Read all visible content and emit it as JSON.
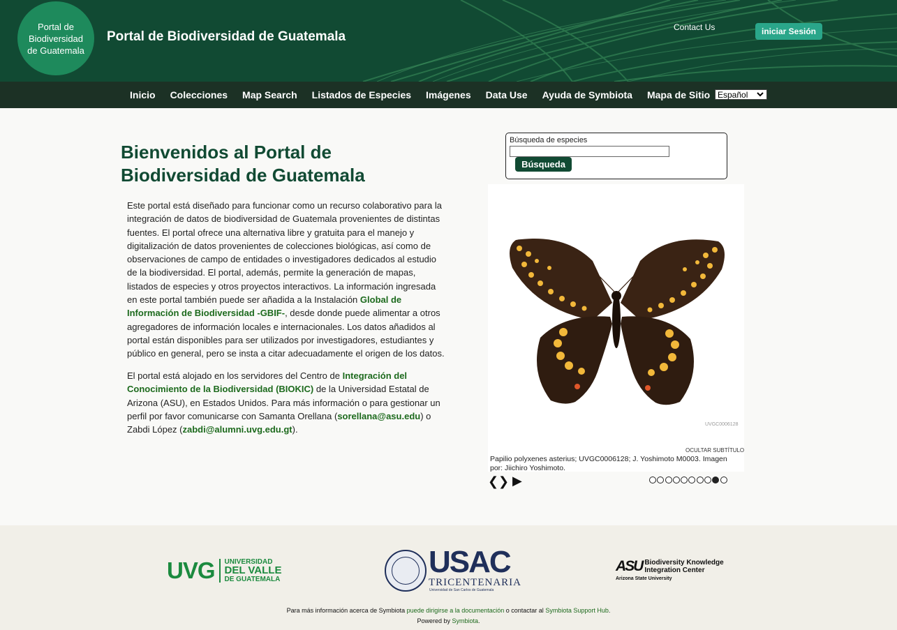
{
  "header": {
    "logo_lines": [
      "Portal de",
      "Biodiversidad",
      "de Guatemala"
    ],
    "site_title": "Portal de Biodiversidad de Guatemala",
    "contact": "Contact Us",
    "login": "iniciar Sesión"
  },
  "nav": {
    "items": [
      "Inicio",
      "Colecciones",
      "Map Search",
      "Listados de Especies",
      "Imágenes",
      "Data Use",
      "Ayuda de Symbiota",
      "Mapa de Sitio"
    ],
    "language": "Español"
  },
  "main": {
    "welcome": "Bienvenidos al Portal de Biodiversidad de Guatemala",
    "p1_before": "Este portal está diseñado para funcionar como un recurso colaborativo para la integración de datos de biodiversidad de Guatemala provenientes de distintas fuentes. El portal ofrece una alternativa libre y gratuita para el manejo y digitalización de datos provenientes de colecciones biológicas, así como de observaciones de campo de entidades o investigadores dedicados al estudio de la biodiversidad. El portal, además, permite la generación de mapas, listados de especies y otros proyectos interactivos. La información ingresada en este portal también puede ser añadida a la Instalación ",
    "p1_link": "Global de Información de Biodiversidad -GBIF-",
    "p1_after": ", desde donde puede alimentar a otros agregadores de información locales e internacionales. Los datos añadidos al portal están disponibles para ser utilizados por investigadores, estudiantes y público en general, pero se insta a citar adecuadamente el origen de los datos.",
    "p2_before": "El portal está alojado en los servidores del Centro de ",
    "p2_link": "Integración del Conocimiento de la Biodiversidad (BIOKIC)",
    "p2_mid": " de la Universidad Estatal de Arizona (ASU), en Estados Unidos. Para más información o para gestionar un perfil por favor comunicarse con Samanta Orellana (",
    "p2_email1": "sorellana@asu.edu",
    "p2_mid2": ") o Zabdi López (",
    "p2_email2": "zabdi@alumni.uvg.edu.gt",
    "p2_end": ")."
  },
  "search": {
    "label": "Búsqueda de especies",
    "value": "",
    "button": "Búsqueda"
  },
  "slideshow": {
    "catalog_number": "UVGC0006128",
    "hide_caption": "OCULTAR SUBTÍTULO",
    "caption_link": "Papilio polyxenes asterius; UVGC0006128; J. Yoshimoto M0003",
    "caption_after": ". Imagen por: Jiichiro Yoshimoto.",
    "prev": "❮",
    "next": "❯",
    "play": "▶",
    "dot_count": 10,
    "active_dot": 8
  },
  "footer": {
    "uvg_big": "UVG",
    "uvg_line1": "UNIVERSIDAD",
    "uvg_line2": "DEL VALLE",
    "uvg_line3": "DE GUATEMALA",
    "usac_title": "USAC",
    "usac_sub": "TRICENTENARIA",
    "usac_sub2": "Universidad de San Carlos de Guatemala",
    "asu_mark": "ASU",
    "asu_line1": "Biodiversity Knowledge",
    "asu_line2": "Integration Center",
    "asu_uni": "Arizona State University",
    "line1_before": "Para más información acerca de Symbiota ",
    "line1_link1": "puede dirigirse a la documentación",
    "line1_mid": " o contactar al ",
    "line1_link2": "Symbiota Support Hub",
    "line1_end": ".",
    "line2_before": "Powered by ",
    "line2_link": "Symbiota",
    "line2_end": "."
  }
}
